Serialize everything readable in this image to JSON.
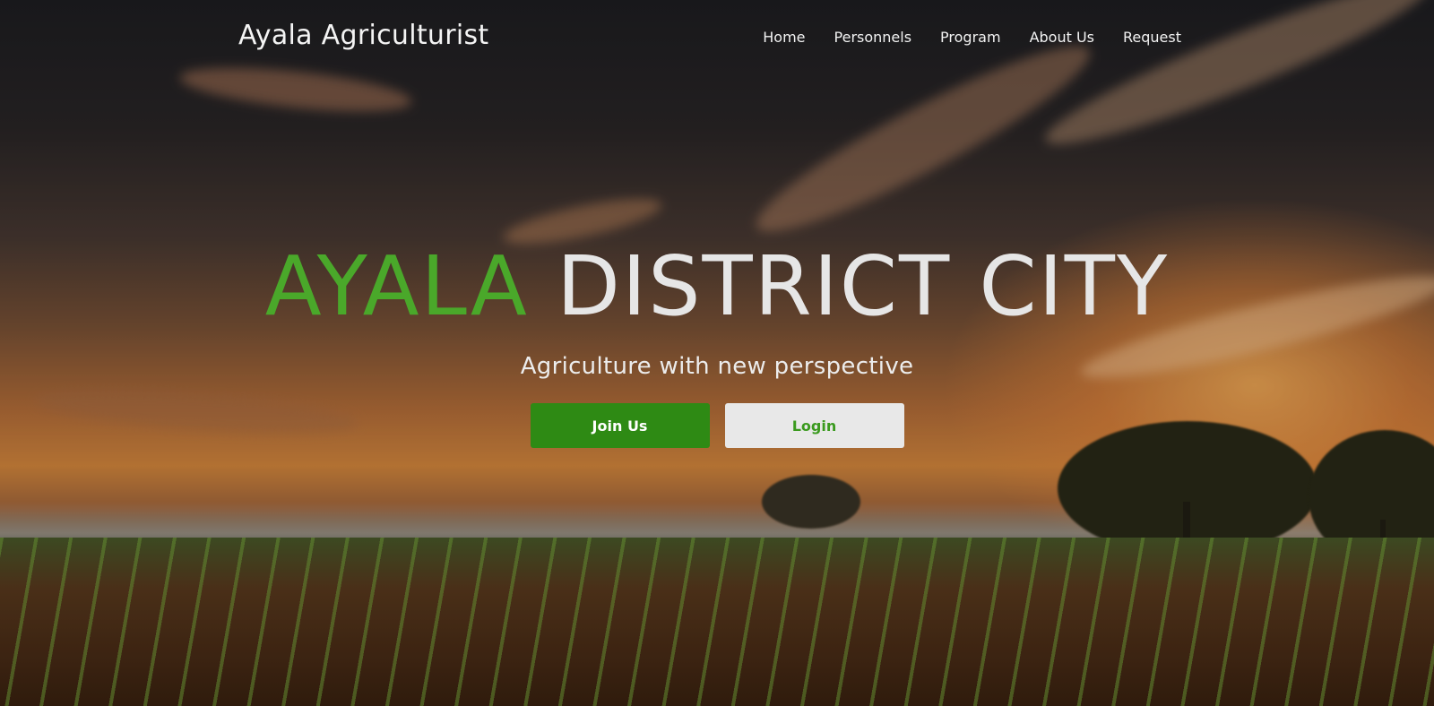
{
  "nav": {
    "brand": "Ayala Agriculturist",
    "items": [
      {
        "label": "Home"
      },
      {
        "label": "Personnels"
      },
      {
        "label": "Program"
      },
      {
        "label": "About Us"
      },
      {
        "label": "Request"
      }
    ]
  },
  "hero": {
    "headline_accent": "AYALA",
    "headline_rest": "DISTRICT CITY",
    "tagline": "Agriculture with new perspective",
    "buttons": {
      "join_label": "Join Us",
      "login_label": "Login"
    }
  },
  "colors": {
    "accent_green": "#4aa82a",
    "button_green": "#2e8a14",
    "button_light": "#e8e8e8"
  }
}
